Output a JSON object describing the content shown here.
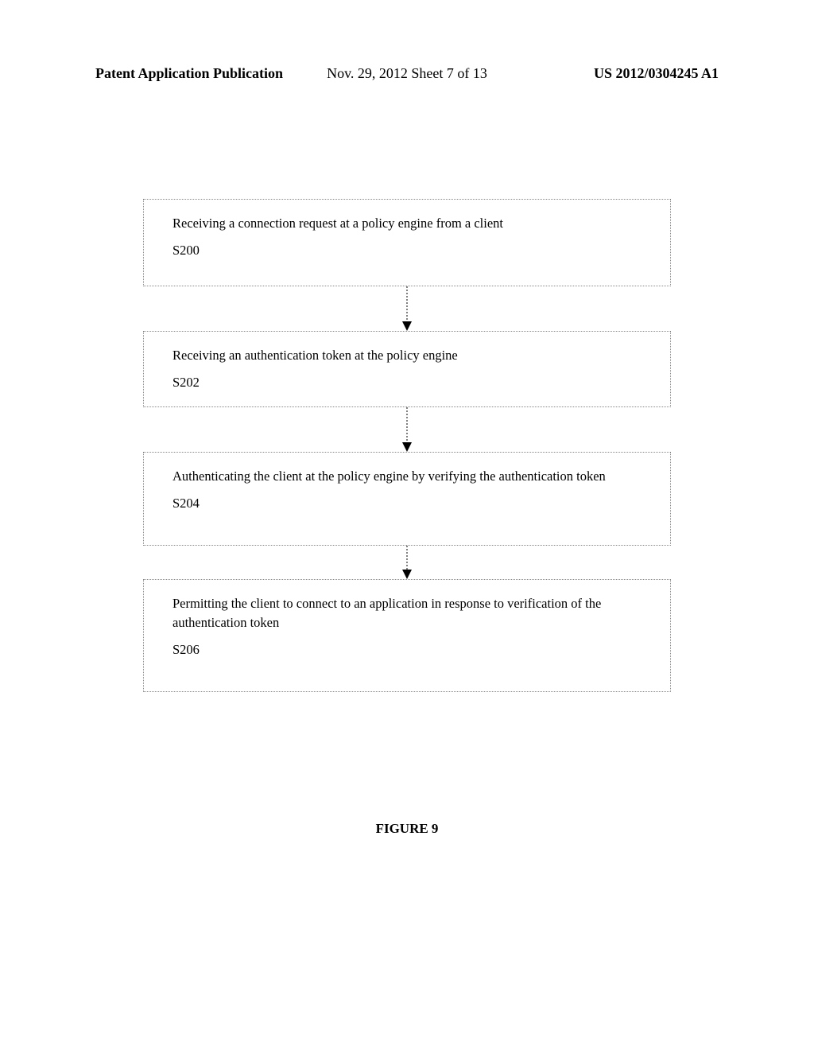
{
  "header": {
    "left": "Patent Application Publication",
    "center": "Nov. 29, 2012  Sheet 7 of 13",
    "right": "US 2012/0304245 A1"
  },
  "flowchart": {
    "steps": [
      {
        "text": "Receiving a connection request at a policy engine from a client",
        "label": "S200"
      },
      {
        "text": "Receiving an authentication token at the policy engine",
        "label": "S202"
      },
      {
        "text": "Authenticating the client at the policy engine by verifying the authentication token",
        "label": "S204"
      },
      {
        "text": "Permitting the client to connect to an application in response to verification of the authentication token",
        "label": "S206"
      }
    ]
  },
  "figure_label": "FIGURE 9"
}
